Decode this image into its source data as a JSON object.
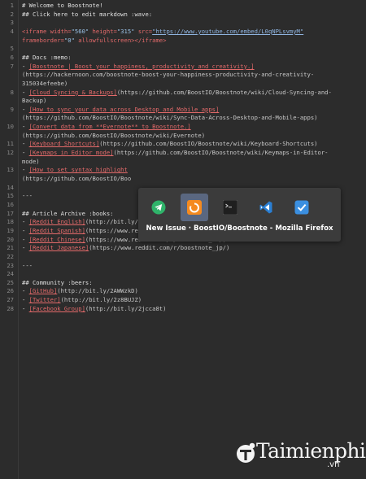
{
  "editor": {
    "lines": [
      {
        "num": "1",
        "segs": [
          {
            "t": "# Welcome to Boostnote!",
            "c": "c-head"
          }
        ]
      },
      {
        "num": "2",
        "segs": [
          {
            "t": "## Click here to edit markdown :wave:",
            "c": "c-head"
          }
        ]
      },
      {
        "num": "3",
        "segs": []
      },
      {
        "num": "4",
        "segs": [
          {
            "t": "<iframe ",
            "c": "c-tag"
          },
          {
            "t": "width=",
            "c": "c-tag"
          },
          {
            "t": "\"560\"",
            "c": "c-str"
          },
          {
            "t": " height=",
            "c": "c-tag"
          },
          {
            "t": "\"315\"",
            "c": "c-str"
          },
          {
            "t": " src=",
            "c": "c-tag"
          },
          {
            "t": "\"https://www.youtube.com/embed/L0qNPLsvmyM\"",
            "c": "c-url"
          }
        ]
      },
      {
        "num": "",
        "segs": [
          {
            "t": "frameborder=",
            "c": "c-tag"
          },
          {
            "t": "\"0\"",
            "c": "c-str"
          },
          {
            "t": " allowfullscreen",
            "c": "c-tag"
          },
          {
            "t": "></iframe>",
            "c": "c-tag"
          }
        ]
      },
      {
        "num": "5",
        "segs": []
      },
      {
        "num": "6",
        "segs": [
          {
            "t": "## Docs :memo:",
            "c": "c-head"
          }
        ]
      },
      {
        "num": "7",
        "segs": [
          {
            "t": "- ",
            "c": "c-text"
          },
          {
            "t": "[Boostnote | Boost your happiness, productivity and creativity.]",
            "c": "c-link"
          }
        ]
      },
      {
        "num": "",
        "segs": [
          {
            "t": "(https://hackernoon.com/boostnote-boost-your-happiness-productivity-and-creativity-",
            "c": "c-paren"
          }
        ]
      },
      {
        "num": "",
        "segs": [
          {
            "t": "315034efeebe)",
            "c": "c-paren"
          }
        ]
      },
      {
        "num": "8",
        "segs": [
          {
            "t": "- ",
            "c": "c-text"
          },
          {
            "t": "[Cloud Syncing & Backups]",
            "c": "c-link"
          },
          {
            "t": "(https://github.com/BoostIO/Boostnote/wiki/Cloud-Syncing-and-",
            "c": "c-paren"
          }
        ]
      },
      {
        "num": "",
        "segs": [
          {
            "t": "Backup)",
            "c": "c-paren"
          }
        ]
      },
      {
        "num": "9",
        "segs": [
          {
            "t": "- ",
            "c": "c-text"
          },
          {
            "t": "[How to sync your data across Desktop and Mobile apps]",
            "c": "c-link"
          }
        ]
      },
      {
        "num": "",
        "segs": [
          {
            "t": "(https://github.com/BoostIO/Boostnote/wiki/Sync-Data-Across-Desktop-and-Mobile-apps)",
            "c": "c-paren"
          }
        ]
      },
      {
        "num": "10",
        "segs": [
          {
            "t": "- ",
            "c": "c-text"
          },
          {
            "t": "[Convert data from **Evernote** to Boostnote.]",
            "c": "c-link"
          }
        ]
      },
      {
        "num": "",
        "segs": [
          {
            "t": "(https://github.com/BoostIO/Boostnote/wiki/Evernote)",
            "c": "c-paren"
          }
        ]
      },
      {
        "num": "11",
        "segs": [
          {
            "t": "- ",
            "c": "c-text"
          },
          {
            "t": "[Keyboard Shortcuts]",
            "c": "c-link"
          },
          {
            "t": "(https://github.com/BoostIO/Boostnote/wiki/Keyboard-Shortcuts)",
            "c": "c-paren"
          }
        ]
      },
      {
        "num": "12",
        "segs": [
          {
            "t": "- ",
            "c": "c-text"
          },
          {
            "t": "[Keymaps in Editor mode]",
            "c": "c-link"
          },
          {
            "t": "(https://github.com/BoostIO/Boostnote/wiki/Keymaps-in-Editor-",
            "c": "c-paren"
          }
        ]
      },
      {
        "num": "",
        "segs": [
          {
            "t": "mode)",
            "c": "c-paren"
          }
        ]
      },
      {
        "num": "13",
        "segs": [
          {
            "t": "- ",
            "c": "c-text"
          },
          {
            "t": "[How to set syntax highlight",
            "c": "c-link"
          }
        ]
      },
      {
        "num": "",
        "segs": [
          {
            "t": "(https://github.com/BoostIO/Boo",
            "c": "c-paren"
          }
        ]
      },
      {
        "num": "14",
        "segs": []
      },
      {
        "num": "15",
        "segs": [
          {
            "t": "---",
            "c": "c-text"
          }
        ]
      },
      {
        "num": "16",
        "segs": []
      },
      {
        "num": "17",
        "segs": [
          {
            "t": "## Article Archive :books:",
            "c": "c-head"
          }
        ]
      },
      {
        "num": "18",
        "segs": [
          {
            "t": "- ",
            "c": "c-text"
          },
          {
            "t": "[Reddit English]",
            "c": "c-link"
          },
          {
            "t": "(http://bit.ly/2mOJPu7)",
            "c": "c-paren"
          }
        ]
      },
      {
        "num": "19",
        "segs": [
          {
            "t": "- ",
            "c": "c-text"
          },
          {
            "t": "[Reddit Spanish]",
            "c": "c-link"
          },
          {
            "t": "(https://www.reddit.com/r/boostnote_es/)",
            "c": "c-paren"
          }
        ]
      },
      {
        "num": "20",
        "segs": [
          {
            "t": "- ",
            "c": "c-text"
          },
          {
            "t": "[Reddit Chinese]",
            "c": "c-link"
          },
          {
            "t": "(https://www.reddit.com/r/boostnote_cn/)",
            "c": "c-paren"
          }
        ]
      },
      {
        "num": "21",
        "segs": [
          {
            "t": "- ",
            "c": "c-text"
          },
          {
            "t": "[Reddit Japanese]",
            "c": "c-link"
          },
          {
            "t": "(https://www.reddit.com/r/boostnote_jp/)",
            "c": "c-paren"
          }
        ]
      },
      {
        "num": "22",
        "segs": []
      },
      {
        "num": "23",
        "segs": [
          {
            "t": "---",
            "c": "c-text"
          }
        ]
      },
      {
        "num": "24",
        "segs": []
      },
      {
        "num": "25",
        "segs": [
          {
            "t": "## Community :beers:",
            "c": "c-head"
          }
        ]
      },
      {
        "num": "26",
        "segs": [
          {
            "t": "- ",
            "c": "c-text"
          },
          {
            "t": "[GitHub]",
            "c": "c-link"
          },
          {
            "t": "(http://bit.ly/2AWWzkD)",
            "c": "c-paren"
          }
        ]
      },
      {
        "num": "27",
        "segs": [
          {
            "t": "- ",
            "c": "c-text"
          },
          {
            "t": "[Twitter]",
            "c": "c-link"
          },
          {
            "t": "(http://bit.ly/2z8BUJZ)",
            "c": "c-paren"
          }
        ]
      },
      {
        "num": "28",
        "segs": [
          {
            "t": "- ",
            "c": "c-text"
          },
          {
            "t": "[Facebook Group]",
            "c": "c-link"
          },
          {
            "t": "(http://bit.ly/2jcca8t)",
            "c": "c-paren"
          }
        ]
      }
    ]
  },
  "switcher": {
    "title": "New Issue · BoostIO/Boostnote - Mozilla Firefox",
    "apps": [
      {
        "name": "telegram-icon",
        "color": "#2fb36a"
      },
      {
        "name": "firefox-icon",
        "color": "#f58a1f",
        "active": true
      },
      {
        "name": "terminal-icon",
        "color": "#1f1f1f"
      },
      {
        "name": "vscode-icon",
        "color": "#2a7fd4"
      },
      {
        "name": "checkbox-app-icon",
        "color": "#3b8fe0"
      }
    ]
  },
  "watermark": {
    "text": "Taimienphi",
    "suffix": ".vn"
  },
  "colors": {
    "background": "#2c2c2c",
    "link": "#e36a6a",
    "url": "#8fb4e0",
    "switcher_bg": "#3b3b3b",
    "active_app": "#5a6780"
  }
}
